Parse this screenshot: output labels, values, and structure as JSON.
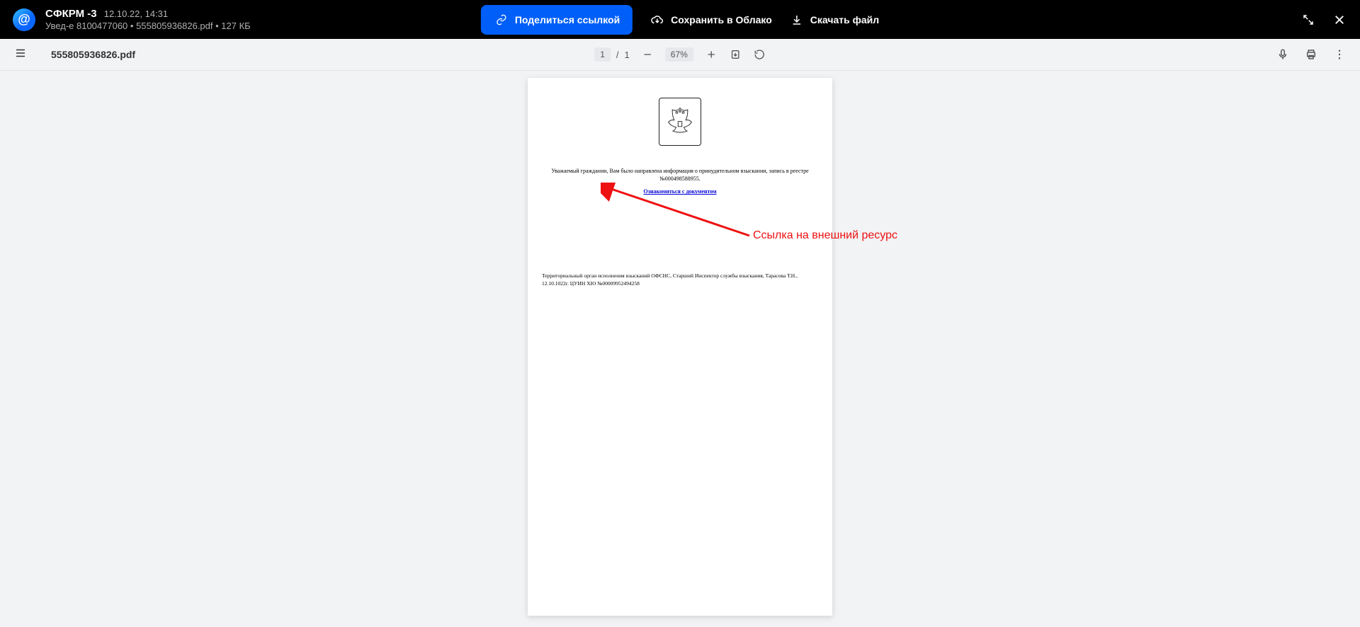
{
  "header": {
    "sender": "СФКРМ -3",
    "datetime": "12.10.22, 14:31",
    "subtitle": "Увед-е 8100477060 • 555805936826.pdf • 127 КБ",
    "share_label": "Поделиться ссылкой",
    "save_cloud_label": "Сохранить в Облако",
    "download_label": "Скачать файл"
  },
  "viewer": {
    "file_name": "555805936826.pdf",
    "page_current": "1",
    "page_sep": "/",
    "page_total": "1",
    "zoom": "67%"
  },
  "document": {
    "paragraph1": "Уважаемый гражданин, Вам было направлена информация о принудительном взыскании, запись в реестре №000498588955.",
    "link_text": "Ознакомиться с документом",
    "footer_text": "Территориальный орган исполнения взысканий ОФСНС, Старший Инспектор службы взыскания, Тарасова Т.Н., 12.10.1022г. ЦУИН ХЮ №00009952494258"
  },
  "annotation": {
    "label": "Ссылка на внешний ресурс"
  }
}
